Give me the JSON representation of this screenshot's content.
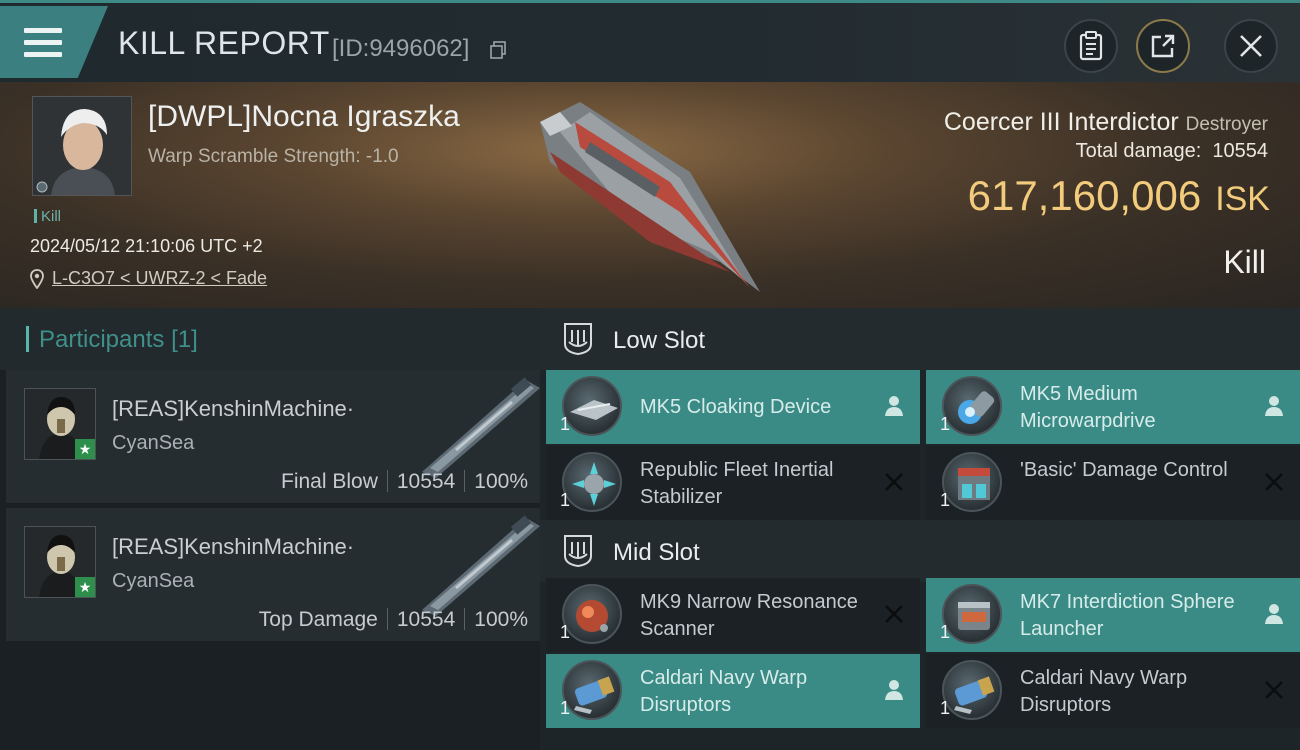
{
  "header": {
    "title": "KILL REPORT",
    "kill_id": "[ID:9496062]"
  },
  "victim": {
    "name": "[DWPL]Nocna Igraszka",
    "subtitle": "Warp Scramble Strength: -1.0",
    "tag": "Kill",
    "datetime": "2024/05/12 21:10:06 UTC +2",
    "location": "L-C3O7 < UWRZ-2 < Fade",
    "ship": "Coercer III Interdictor",
    "ship_class": "Destroyer",
    "total_damage_label": "Total damage:",
    "total_damage": "10554",
    "isk_value": "617,160,006",
    "isk_unit": "ISK",
    "result": "Kill"
  },
  "participants": {
    "title": "Participants",
    "count": "[1]",
    "rows": [
      {
        "name": "[REAS]KenshinMachine·",
        "corp": "CyanSea",
        "role": "Final Blow",
        "damage": "10554",
        "percent": "100%"
      },
      {
        "name": "[REAS]KenshinMachine·",
        "corp": "CyanSea",
        "role": "Top Damage",
        "damage": "10554",
        "percent": "100%"
      }
    ]
  },
  "fitting": {
    "low_slot": {
      "title": "Low Slot",
      "modules": [
        {
          "name": "MK5 Cloaking Device",
          "qty": "1",
          "status": "dropped"
        },
        {
          "name": "MK5 Medium Microwarpdrive",
          "qty": "1",
          "status": "dropped"
        },
        {
          "name": "Republic Fleet Inertial Stabilizer",
          "qty": "1",
          "status": "destroyed"
        },
        {
          "name": "'Basic' Damage Control",
          "qty": "1",
          "status": "destroyed"
        }
      ]
    },
    "mid_slot": {
      "title": "Mid Slot",
      "modules": [
        {
          "name": "MK9 Narrow Resonance Scanner",
          "qty": "1",
          "status": "destroyed"
        },
        {
          "name": "MK7 Interdiction Sphere Launcher",
          "qty": "1",
          "status": "dropped"
        },
        {
          "name": "Caldari Navy Warp Disruptors",
          "qty": "1",
          "status": "dropped"
        },
        {
          "name": "Caldari Navy Warp Disruptors",
          "qty": "1",
          "status": "destroyed"
        }
      ]
    }
  },
  "icons": {
    "menu": "menu-icon",
    "copy": "copy-icon",
    "clipboard": "clipboard-icon",
    "share": "share-icon",
    "close": "close-icon",
    "location": "location-pin-icon",
    "dropped": "person-icon",
    "destroyed": "x-icon",
    "slot": "shield-slot-icon"
  },
  "colors": {
    "accent": "#3b7f80",
    "isk": "#f2cc7c",
    "dropped_bg": "#3a8b85",
    "destroyed_bg": "#1b2125"
  }
}
